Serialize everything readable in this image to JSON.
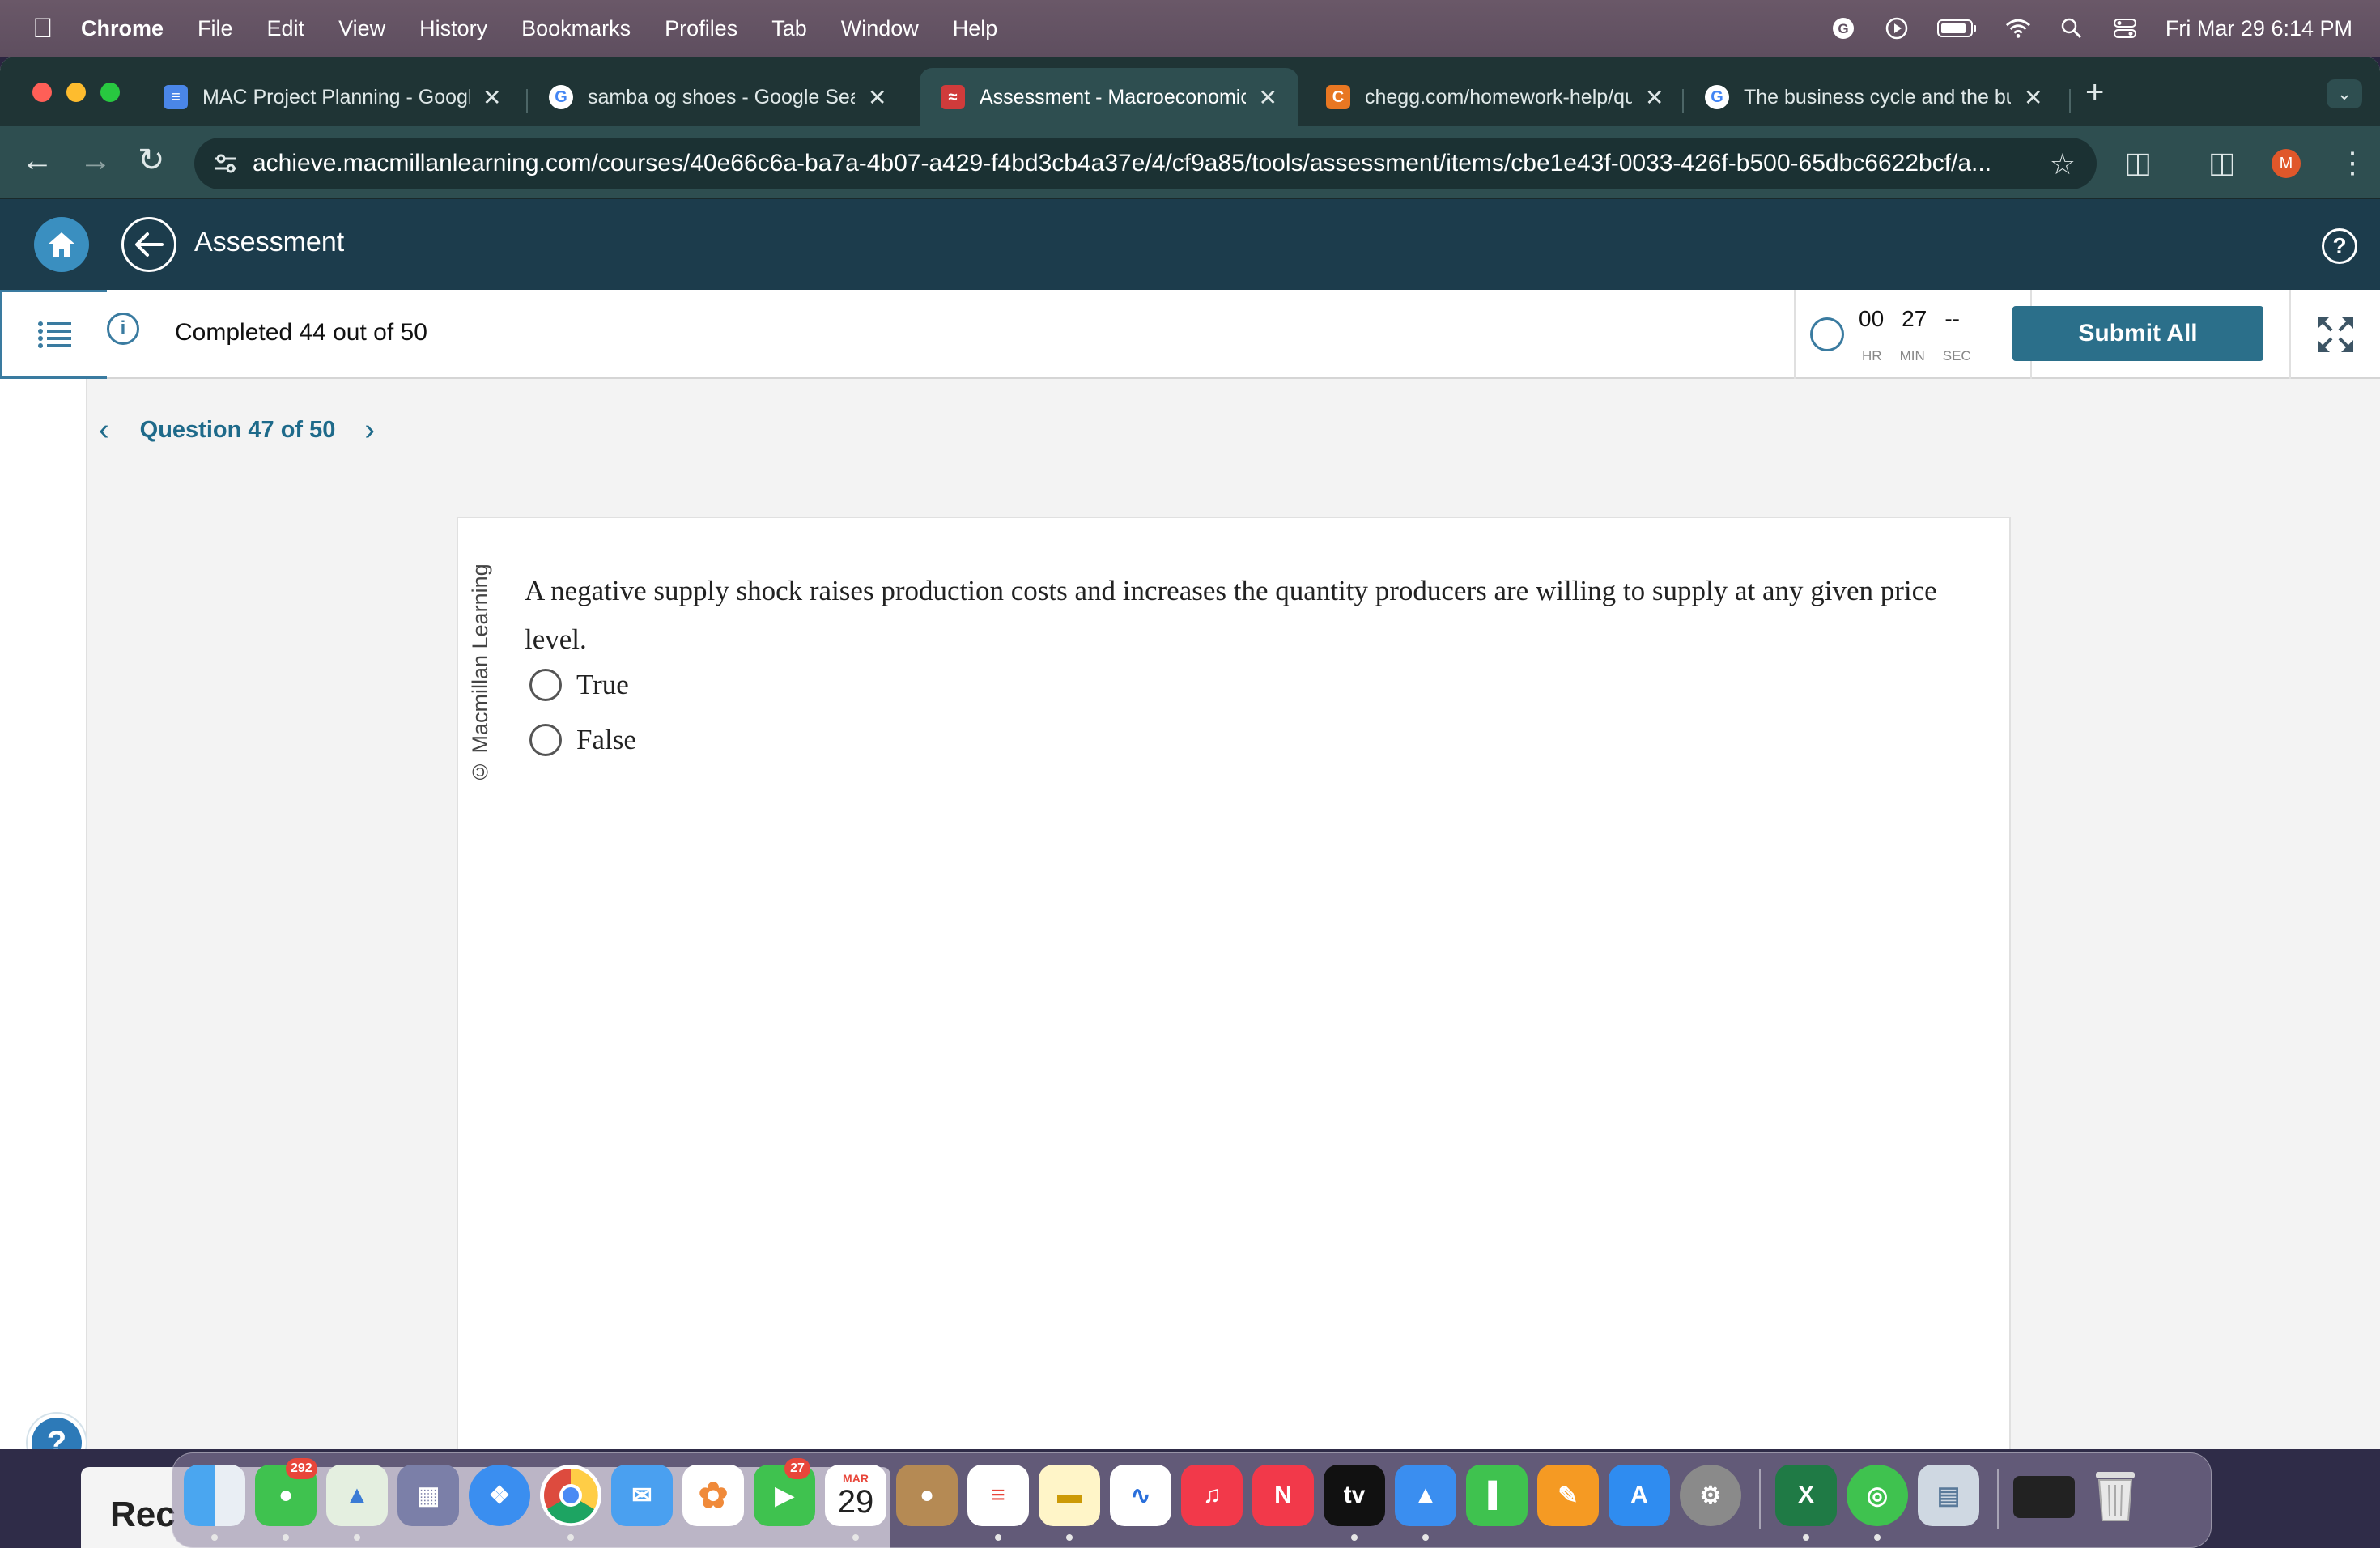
{
  "menubar": {
    "app": "Chrome",
    "items": [
      "File",
      "Edit",
      "View",
      "History",
      "Bookmarks",
      "Profiles",
      "Tab",
      "Window",
      "Help"
    ],
    "datetime": "Fri Mar 29  6:14 PM"
  },
  "tabs": [
    {
      "title": "MAC Project Planning - Google Docs",
      "favicon": "docs-icon",
      "color": "#4a86e8"
    },
    {
      "title": "samba og shoes - Google Search",
      "favicon": "google-icon",
      "color": "#ffffff"
    },
    {
      "title": "Assessment - Macroeconomics",
      "favicon": "macmillan-icon",
      "color": "#d03b3b",
      "active": true
    },
    {
      "title": "chegg.com/homework-help/questions",
      "favicon": "chegg-icon",
      "color": "#e87722"
    },
    {
      "title": "The business cycle and the business",
      "favicon": "google-icon",
      "color": "#ffffff"
    }
  ],
  "url": "achieve.macmillanlearning.com/courses/40e66c6a-ba7a-4b07-a429-f4bd3cb4a37e/4/cf9a85/tools/assessment/items/cbe1e43f-0033-426f-b500-65dbc6622bcf/a...",
  "profile_initial": "M",
  "app": {
    "title": "Assessment",
    "progress": "Completed 44 out of 50",
    "timer": {
      "hr": "00",
      "min": "27",
      "sec": "--",
      "hr_label": "HR",
      "min_label": "MIN",
      "sec_label": "SEC"
    },
    "submit_label": "Submit All",
    "question_nav": "Question 47 of 50",
    "copyright": "© Macmillan Learning",
    "question": "A negative supply shock raises production costs and increases the quantity producers are willing to supply at any given price level.",
    "options": [
      "True",
      "False"
    ],
    "help_label": "?"
  },
  "desktop": {
    "behind_window_text": "Rec"
  },
  "dock": {
    "messages_badge": "292",
    "facetime_badge": "27",
    "calendar_month": "MAR",
    "calendar_day": "29",
    "tv_label": "tv"
  },
  "colors": {
    "app_header": "#1c3c4c",
    "accent": "#2b6f8a",
    "tabstrip": "#1f3435"
  }
}
